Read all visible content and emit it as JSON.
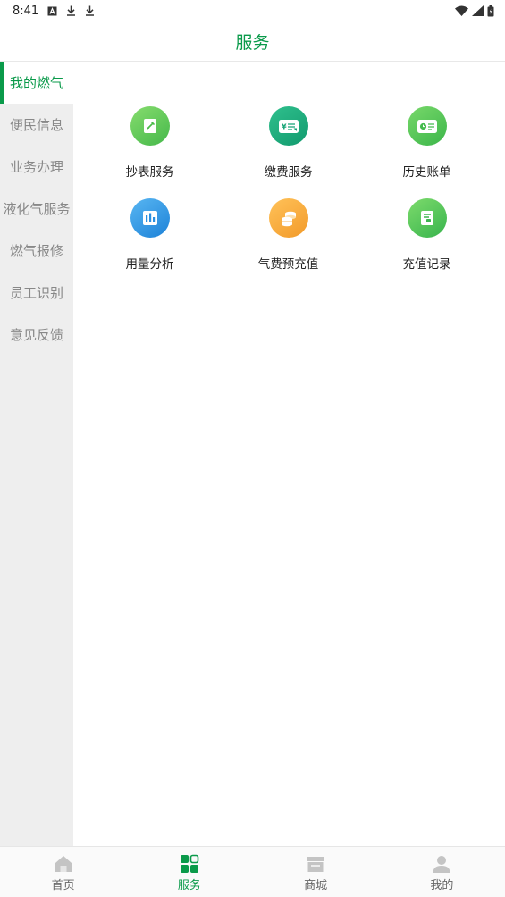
{
  "status_bar": {
    "time": "8:41"
  },
  "header": {
    "title": "服务"
  },
  "sidebar": {
    "items": [
      {
        "label": "我的燃气",
        "active": true
      },
      {
        "label": "便民信息"
      },
      {
        "label": "业务办理"
      },
      {
        "label": "液化气服务"
      },
      {
        "label": "燃气报修"
      },
      {
        "label": "员工识别"
      },
      {
        "label": "意见反馈"
      }
    ]
  },
  "services": [
    {
      "label": "抄表服务",
      "icon": "pencil-note-icon",
      "color": "#5cc84e"
    },
    {
      "label": "缴费服务",
      "icon": "yuan-card-icon",
      "color": "#1aa77a"
    },
    {
      "label": "历史账单",
      "icon": "bill-clock-icon",
      "color": "#4cc251"
    },
    {
      "label": "用量分析",
      "icon": "bar-chart-icon",
      "color": "#2e95e3"
    },
    {
      "label": "气费预充值",
      "icon": "coins-icon",
      "color": "#f5a93a"
    },
    {
      "label": "充值记录",
      "icon": "receipt-icon",
      "color": "#49c159"
    }
  ],
  "bottom_nav": {
    "items": [
      {
        "label": "首页",
        "icon": "home-icon"
      },
      {
        "label": "服务",
        "icon": "grid-icon",
        "active": true
      },
      {
        "label": "商城",
        "icon": "shop-icon"
      },
      {
        "label": "我的",
        "icon": "person-icon"
      }
    ]
  },
  "colors": {
    "accent": "#0a9a4a",
    "sidebar_bg": "#eeeeee"
  }
}
